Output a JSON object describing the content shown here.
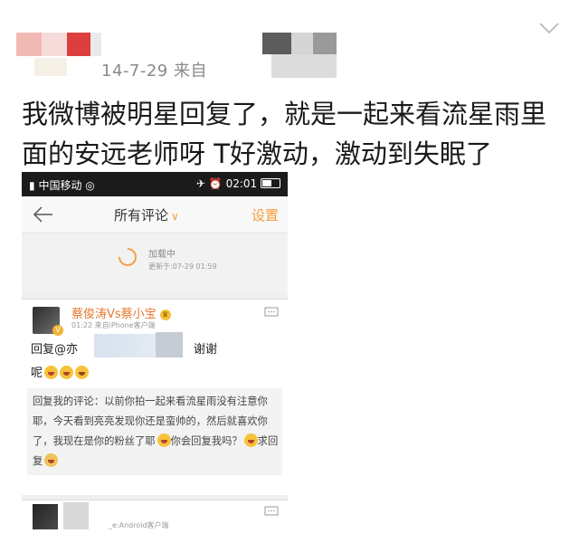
{
  "post": {
    "meta": "14-7-29  来自",
    "text": "我微博被明星回复了，就是一起来看流星雨里面的安远老师呀 T好激动，激动到失眠了"
  },
  "phone": {
    "status_left": "&#8286;&#8286; 中国移动",
    "carrier": "中国移动",
    "time": "02:01",
    "title": "所有评论",
    "title_caret": "∨",
    "settings": "设置",
    "loading_title": "加载中",
    "loading_time": "更新于:07-29 01:59",
    "comment": {
      "username": "蔡俊涛Vs蔡小宝",
      "time_source": "01:22  来自iPhone客户端",
      "reply_prefix": "回复@亦",
      "thanks": "谢谢",
      "line2": "呢",
      "quote": "回复我的评论：以前你拍一起来看流星雨没有注意你耶，今天看到亮亮发现你还是蛮帅的，然后就喜欢你了，我现在是你的粉丝了耶",
      "quote_mid": "你会回复我吗？",
      "quote_end": "求回复"
    },
    "next_source": "_e:Android客户端"
  },
  "colors": {
    "accent_orange": "#f39c3a",
    "username_orange": "#e8762d",
    "link_blue": "#3d77b5",
    "statusbar": "#1b1b1b"
  }
}
